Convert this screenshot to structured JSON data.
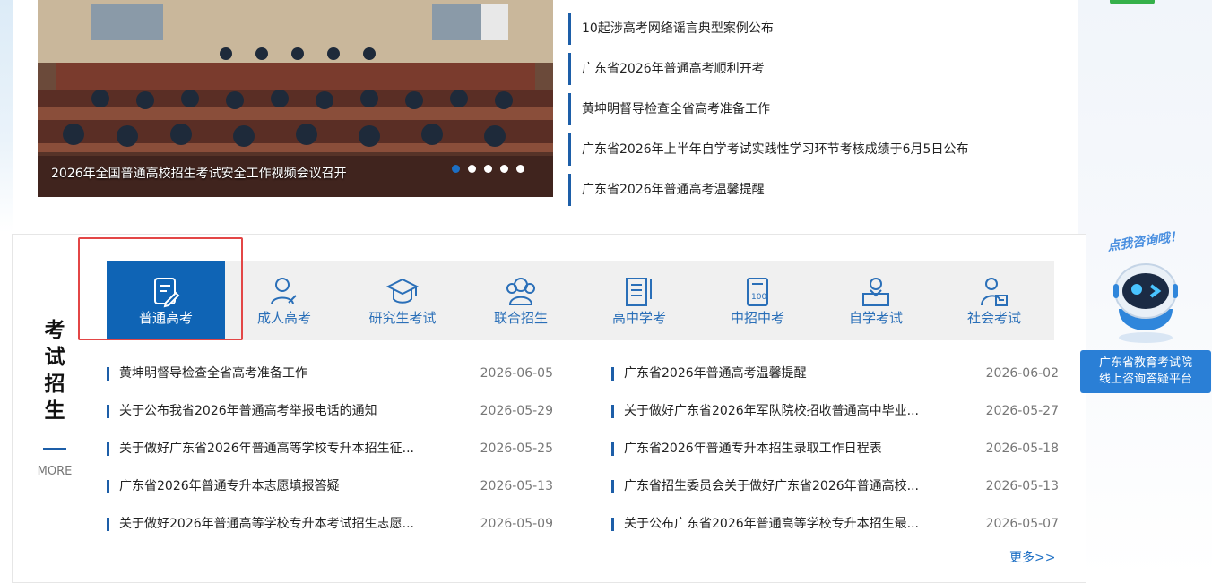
{
  "banner": {
    "caption": "2026年全国普通高校招生考试安全工作视频会议召开",
    "slide_count": 5,
    "active_slide": 1
  },
  "news": [
    "10起涉高考网络谣言典型案例公布",
    "广东省2026年普通高考顺利开考",
    "黄坤明督导检查全省高考准备工作",
    "广东省2026年上半年自学考试实践性学习环节考核成绩于6月5日公布",
    "广东省2026年普通高考温馨提醒"
  ],
  "side": {
    "title": [
      "考",
      "试",
      "招",
      "生"
    ],
    "more": "MORE"
  },
  "tabs": [
    {
      "label": "普通高考",
      "icon": "edit-document-icon"
    },
    {
      "label": "成人高考",
      "icon": "adult-person-icon"
    },
    {
      "label": "研究生考试",
      "icon": "graduation-cap-icon"
    },
    {
      "label": "联合招生",
      "icon": "group-people-icon"
    },
    {
      "label": "高中学考",
      "icon": "notebook-pen-icon"
    },
    {
      "label": "中招中考",
      "icon": "score-sheet-icon"
    },
    {
      "label": "自学考试",
      "icon": "self-study-icon"
    },
    {
      "label": "社会考试",
      "icon": "social-exam-icon"
    }
  ],
  "active_tab": "普通高考",
  "list_left": [
    {
      "title": "黄坤明督导检查全省高考准备工作",
      "date": "2026-06-05"
    },
    {
      "title": "关于公布我省2026年普通高考举报电话的通知",
      "date": "2026-05-29"
    },
    {
      "title": "关于做好广东省2026年普通高等学校专升本招生征...",
      "date": "2026-05-25"
    },
    {
      "title": "广东省2026年普通专升本志愿填报答疑",
      "date": "2026-05-13"
    },
    {
      "title": "关于做好2026年普通高等学校专升本考试招生志愿...",
      "date": "2026-05-09"
    }
  ],
  "list_right": [
    {
      "title": "广东省2026年普通高考温馨提醒",
      "date": "2026-06-02"
    },
    {
      "title": "关于做好广东省2026年军队院校招收普通高中毕业...",
      "date": "2026-05-27"
    },
    {
      "title": "广东省2026年普通专升本招生录取工作日程表",
      "date": "2026-05-18"
    },
    {
      "title": "广东省招生委员会关于做好广东省2026年普通高校...",
      "date": "2026-05-13"
    },
    {
      "title": "关于公布广东省2026年普通高等学校专升本招生最...",
      "date": "2026-05-07"
    }
  ],
  "more_link": "更多>>",
  "consult": {
    "bubble": "点我咨询哦！",
    "badge_line1": "广东省教育考试院",
    "badge_line2": "线上咨询答疑平台"
  },
  "colors": {
    "accent": "#0f64b5",
    "border_accent": "#1d5ea8",
    "highlight": "#e34646"
  }
}
